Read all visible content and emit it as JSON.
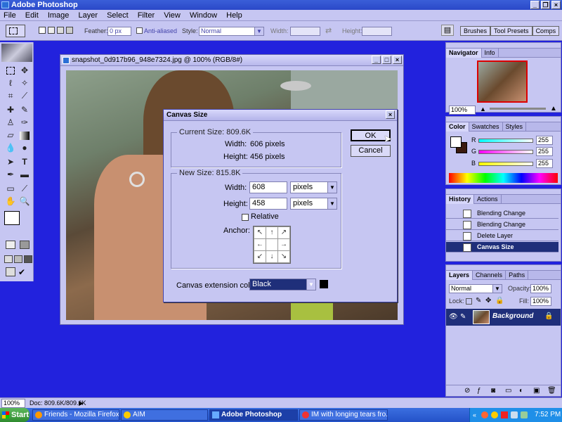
{
  "app": {
    "title": "Adobe Photoshop"
  },
  "menu": [
    "File",
    "Edit",
    "Image",
    "Layer",
    "Select",
    "Filter",
    "View",
    "Window",
    "Help"
  ],
  "options": {
    "feather_label": "Feather:",
    "feather_value": "0 px",
    "antialiased_label": "Anti-aliased",
    "style_label": "Style:",
    "style_value": "Normal",
    "width_label": "Width:",
    "height_label": "Height:",
    "palette_tabs": [
      "Brushes",
      "Tool Presets",
      "Comps"
    ]
  },
  "document": {
    "title": "snapshot_0d917b96_948e7324.jpg @ 100% (RGB/8#)"
  },
  "dialog": {
    "title": "Canvas Size",
    "current_size_label": "Current Size: 809.6K",
    "current_width_label": "Width:",
    "current_width_value": "606 pixels",
    "current_height_label": "Height:",
    "current_height_value": "456 pixels",
    "new_size_label": "New Size: 815.8K",
    "width_label": "Width:",
    "width_value": "608",
    "width_unit": "pixels",
    "height_label": "Height:",
    "height_value": "458",
    "height_unit": "pixels",
    "relative_label": "Relative",
    "anchor_label": "Anchor:",
    "ext_color_label": "Canvas extension color:",
    "ext_color_value": "Black",
    "ok_label": "OK",
    "cancel_label": "Cancel"
  },
  "navigator": {
    "tabs": [
      "Navigator",
      "Info"
    ],
    "zoom": "100%"
  },
  "color": {
    "tabs": [
      "Color",
      "Swatches",
      "Styles"
    ],
    "channels": [
      {
        "label": "R",
        "value": "255"
      },
      {
        "label": "G",
        "value": "255"
      },
      {
        "label": "B",
        "value": "255"
      }
    ]
  },
  "history": {
    "tabs": [
      "History",
      "Actions"
    ],
    "items": [
      "Blending Change",
      "Blending Change",
      "Delete Layer",
      "Canvas Size"
    ]
  },
  "layers": {
    "tabs": [
      "Layers",
      "Channels",
      "Paths"
    ],
    "blend_mode": "Normal",
    "opacity_label": "Opacity:",
    "opacity_value": "100%",
    "lock_label": "Lock:",
    "fill_label": "Fill:",
    "fill_value": "100%",
    "layer_name": "Background"
  },
  "status": {
    "zoom": "100%",
    "doc": "Doc: 809.6K/809.6K"
  },
  "taskbar": {
    "start": "Start",
    "items": [
      "Friends - Mozilla Firefox",
      "AIM",
      "Adobe Photoshop",
      "IM with longing tears fro..."
    ],
    "clock": "7:52 PM"
  },
  "colors": {
    "accent": "#2222dd",
    "panel": "#c6c6f2",
    "selection": "#1f2f7a"
  }
}
